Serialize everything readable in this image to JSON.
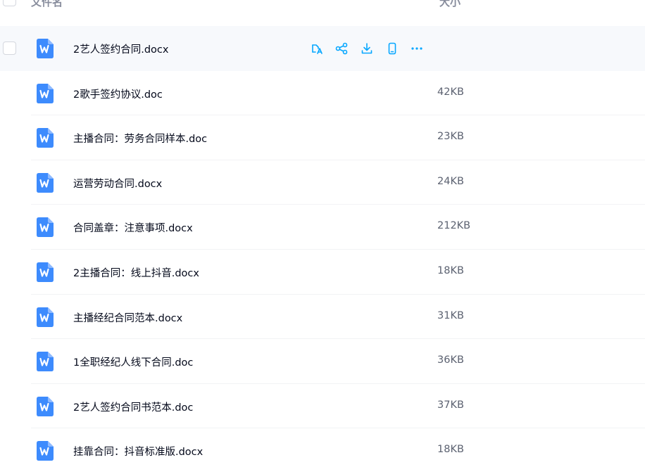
{
  "header": {
    "col_name": "文件名",
    "col_size": "大小"
  },
  "colors": {
    "accent": "#06a7ff",
    "file_icon": "#3d8bfd",
    "hover_row": "#f7f9fc"
  },
  "files": [
    {
      "name": "2艺人签约合同.docx",
      "size": "",
      "icon": "word-doc-icon",
      "hovered": true
    },
    {
      "name": "2歌手签约协议.doc",
      "size": "42KB",
      "icon": "word-doc-icon"
    },
    {
      "name": "主播合同：劳务合同样本.doc",
      "size": "23KB",
      "icon": "word-doc-icon"
    },
    {
      "name": "运营劳动合同.docx",
      "size": "24KB",
      "icon": "word-doc-icon"
    },
    {
      "name": "合同盖章：注意事项.docx",
      "size": "212KB",
      "icon": "word-doc-icon"
    },
    {
      "name": "2主播合同：线上抖音.docx",
      "size": "18KB",
      "icon": "word-doc-icon"
    },
    {
      "name": "主播经纪合同范本.docx",
      "size": "31KB",
      "icon": "word-doc-icon"
    },
    {
      "name": "1全职经纪人线下合同.doc",
      "size": "36KB",
      "icon": "word-doc-icon"
    },
    {
      "name": "2艺人签约合同书范本.doc",
      "size": "37KB",
      "icon": "word-doc-icon"
    },
    {
      "name": "挂靠合同：抖音标准版.docx",
      "size": "18KB",
      "icon": "word-doc-icon"
    }
  ],
  "row_actions": [
    "translate-icon",
    "share-icon",
    "download-icon",
    "phone-icon",
    "more-icon"
  ]
}
